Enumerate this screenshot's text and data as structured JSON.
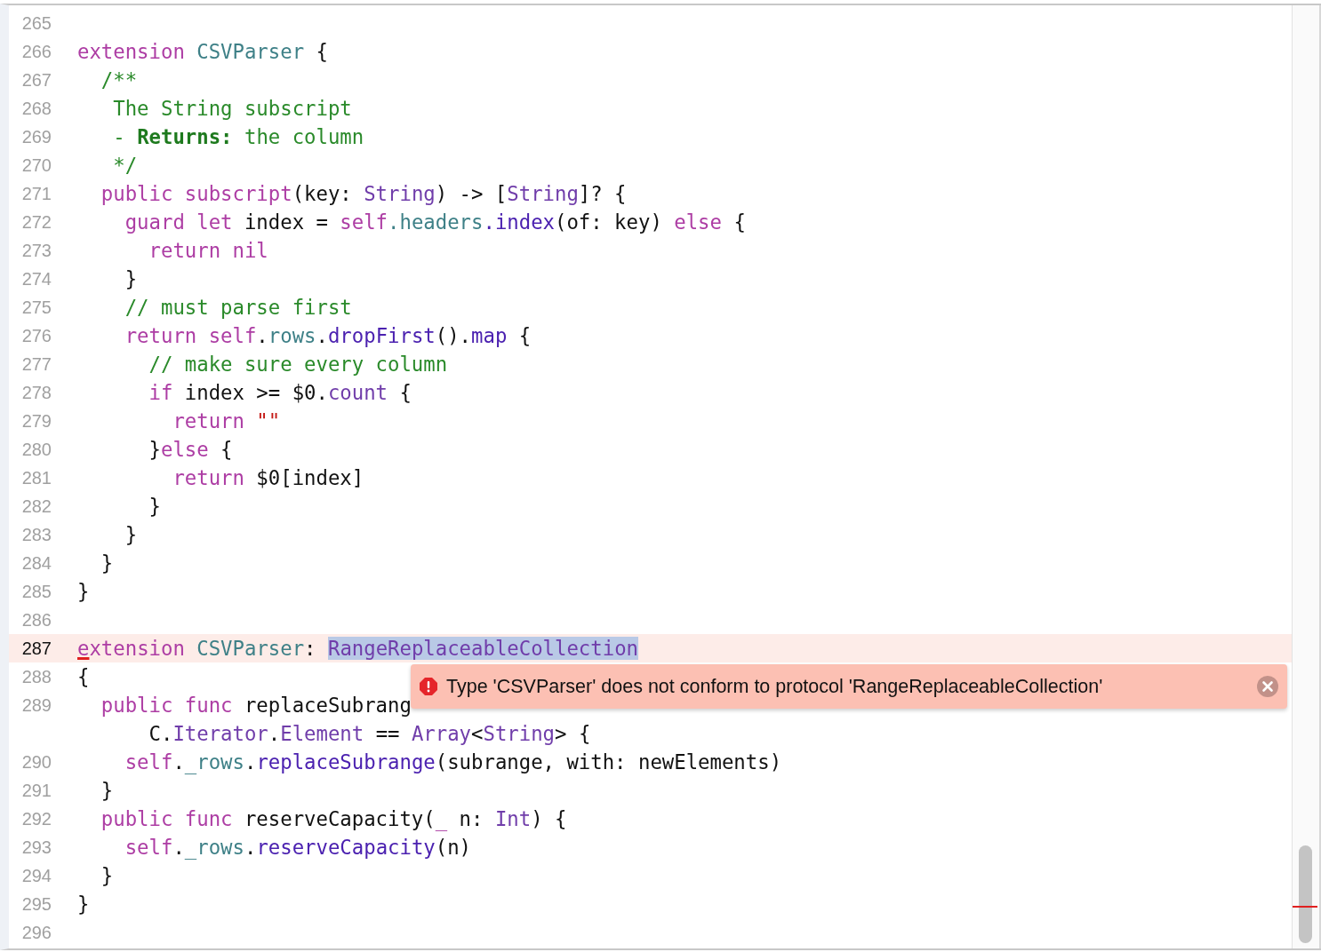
{
  "editor": {
    "lines": [
      {
        "number": "265",
        "current": false
      },
      {
        "number": "266",
        "current": false,
        "tokens": [
          {
            "kind": "keyword",
            "text": "extension "
          },
          {
            "kind": "project",
            "text": "CSVParser"
          },
          {
            "kind": "plain",
            "text": " {"
          }
        ]
      },
      {
        "number": "267",
        "current": false,
        "tokens": [
          {
            "kind": "comment",
            "text": "  /**"
          }
        ]
      },
      {
        "number": "268",
        "current": false,
        "tokens": [
          {
            "kind": "comment",
            "text": "   The String subscript"
          }
        ]
      },
      {
        "number": "269",
        "current": false,
        "tokens": [
          {
            "kind": "comment",
            "text": "   - "
          },
          {
            "kind": "comment-bold",
            "text": "Returns:"
          },
          {
            "kind": "comment",
            "text": " the column"
          }
        ]
      },
      {
        "number": "270",
        "current": false,
        "tokens": [
          {
            "kind": "comment",
            "text": "   */"
          }
        ]
      },
      {
        "number": "271",
        "current": false,
        "tokens": [
          {
            "kind": "keyword",
            "text": "  public subscript"
          },
          {
            "kind": "plain",
            "text": "(key: "
          },
          {
            "kind": "type",
            "text": "String"
          },
          {
            "kind": "plain",
            "text": ") -> ["
          },
          {
            "kind": "type",
            "text": "String"
          },
          {
            "kind": "plain",
            "text": "]? {"
          }
        ]
      },
      {
        "number": "272",
        "current": false,
        "tokens": [
          {
            "kind": "keyword",
            "text": "    guard let"
          },
          {
            "kind": "plain",
            "text": " index = "
          },
          {
            "kind": "keyword",
            "text": "self"
          },
          {
            "kind": "project",
            "text": ".headers"
          },
          {
            "kind": "method",
            "text": ".index"
          },
          {
            "kind": "plain",
            "text": "(of: key) "
          },
          {
            "kind": "keyword",
            "text": "else"
          },
          {
            "kind": "plain",
            "text": " {"
          }
        ]
      },
      {
        "number": "273",
        "current": false,
        "tokens": [
          {
            "kind": "keyword",
            "text": "      return nil"
          }
        ]
      },
      {
        "number": "274",
        "current": false,
        "tokens": [
          {
            "kind": "plain",
            "text": "    }"
          }
        ]
      },
      {
        "number": "275",
        "current": false,
        "tokens": [
          {
            "kind": "comment",
            "text": "    // must parse first"
          }
        ]
      },
      {
        "number": "276",
        "current": false,
        "tokens": [
          {
            "kind": "keyword",
            "text": "    return self"
          },
          {
            "kind": "plain",
            "text": "."
          },
          {
            "kind": "project",
            "text": "rows"
          },
          {
            "kind": "plain",
            "text": "."
          },
          {
            "kind": "method",
            "text": "dropFirst"
          },
          {
            "kind": "plain",
            "text": "()."
          },
          {
            "kind": "method",
            "text": "map"
          },
          {
            "kind": "plain",
            "text": " {"
          }
        ]
      },
      {
        "number": "277",
        "current": false,
        "tokens": [
          {
            "kind": "comment",
            "text": "      // make sure every column"
          }
        ]
      },
      {
        "number": "278",
        "current": false,
        "tokens": [
          {
            "kind": "keyword",
            "text": "      if"
          },
          {
            "kind": "plain",
            "text": " index >= $0."
          },
          {
            "kind": "type",
            "text": "count"
          },
          {
            "kind": "plain",
            "text": " {"
          }
        ]
      },
      {
        "number": "279",
        "current": false,
        "tokens": [
          {
            "kind": "keyword",
            "text": "        return "
          },
          {
            "kind": "string",
            "text": "\"\""
          }
        ]
      },
      {
        "number": "280",
        "current": false,
        "tokens": [
          {
            "kind": "plain",
            "text": "      }"
          },
          {
            "kind": "keyword",
            "text": "else"
          },
          {
            "kind": "plain",
            "text": " {"
          }
        ]
      },
      {
        "number": "281",
        "current": false,
        "tokens": [
          {
            "kind": "keyword",
            "text": "        return"
          },
          {
            "kind": "plain",
            "text": " $0[index]"
          }
        ]
      },
      {
        "number": "282",
        "current": false,
        "tokens": [
          {
            "kind": "plain",
            "text": "      }"
          }
        ]
      },
      {
        "number": "283",
        "current": false,
        "tokens": [
          {
            "kind": "plain",
            "text": "    }"
          }
        ]
      },
      {
        "number": "284",
        "current": false,
        "tokens": [
          {
            "kind": "plain",
            "text": "  }"
          }
        ]
      },
      {
        "number": "285",
        "current": false,
        "tokens": [
          {
            "kind": "plain",
            "text": "}"
          }
        ]
      },
      {
        "number": "286",
        "current": false
      },
      {
        "number": "287",
        "current": true,
        "tokens": [
          {
            "kind": "error-keyword",
            "text": "e"
          },
          {
            "kind": "keyword",
            "text": "xtension "
          },
          {
            "kind": "project",
            "text": "CSVParser"
          },
          {
            "kind": "plain",
            "text": ": "
          },
          {
            "kind": "selected-type",
            "text": "RangeReplaceableCollection"
          }
        ]
      },
      {
        "number": "288",
        "current": false,
        "tokens": [
          {
            "kind": "plain",
            "text": "{"
          }
        ]
      },
      {
        "number": "289",
        "current": false,
        "tokens": [
          {
            "kind": "keyword",
            "text": "  public func"
          },
          {
            "kind": "plain",
            "text": " replaceSubrang"
          }
        ]
      },
      {
        "current": false,
        "tokens": [
          {
            "kind": "plain",
            "text": "      C."
          },
          {
            "kind": "type",
            "text": "Iterator"
          },
          {
            "kind": "plain",
            "text": "."
          },
          {
            "kind": "type",
            "text": "Element"
          },
          {
            "kind": "plain",
            "text": " == "
          },
          {
            "kind": "type",
            "text": "Array"
          },
          {
            "kind": "plain",
            "text": "<"
          },
          {
            "kind": "type",
            "text": "String"
          },
          {
            "kind": "plain",
            "text": "> {"
          }
        ]
      },
      {
        "number": "290",
        "current": false,
        "tokens": [
          {
            "kind": "keyword",
            "text": "    self"
          },
          {
            "kind": "plain",
            "text": "."
          },
          {
            "kind": "project",
            "text": "_rows"
          },
          {
            "kind": "plain",
            "text": "."
          },
          {
            "kind": "method",
            "text": "replaceSubrange"
          },
          {
            "kind": "plain",
            "text": "(subrange, with: newElements)"
          }
        ]
      },
      {
        "number": "291",
        "current": false,
        "tokens": [
          {
            "kind": "plain",
            "text": "  }"
          }
        ]
      },
      {
        "number": "292",
        "current": false,
        "tokens": [
          {
            "kind": "keyword",
            "text": "  public func"
          },
          {
            "kind": "plain",
            "text": " reserveCapacity("
          },
          {
            "kind": "keyword",
            "text": "_"
          },
          {
            "kind": "plain",
            "text": " n: "
          },
          {
            "kind": "type",
            "text": "Int"
          },
          {
            "kind": "plain",
            "text": ") {"
          }
        ]
      },
      {
        "number": "293",
        "current": false,
        "tokens": [
          {
            "kind": "keyword",
            "text": "    self"
          },
          {
            "kind": "plain",
            "text": "."
          },
          {
            "kind": "project",
            "text": "_rows"
          },
          {
            "kind": "plain",
            "text": "."
          },
          {
            "kind": "method",
            "text": "reserveCapacity"
          },
          {
            "kind": "plain",
            "text": "(n)"
          }
        ]
      },
      {
        "number": "294",
        "current": false,
        "tokens": [
          {
            "kind": "plain",
            "text": "  }"
          }
        ]
      },
      {
        "number": "295",
        "current": false,
        "tokens": [
          {
            "kind": "plain",
            "text": "}"
          }
        ]
      },
      {
        "number": "296",
        "current": false
      }
    ]
  },
  "error_banner": {
    "message": "Type 'CSVParser' does not conform to protocol 'RangeReplaceableCollection'"
  }
}
